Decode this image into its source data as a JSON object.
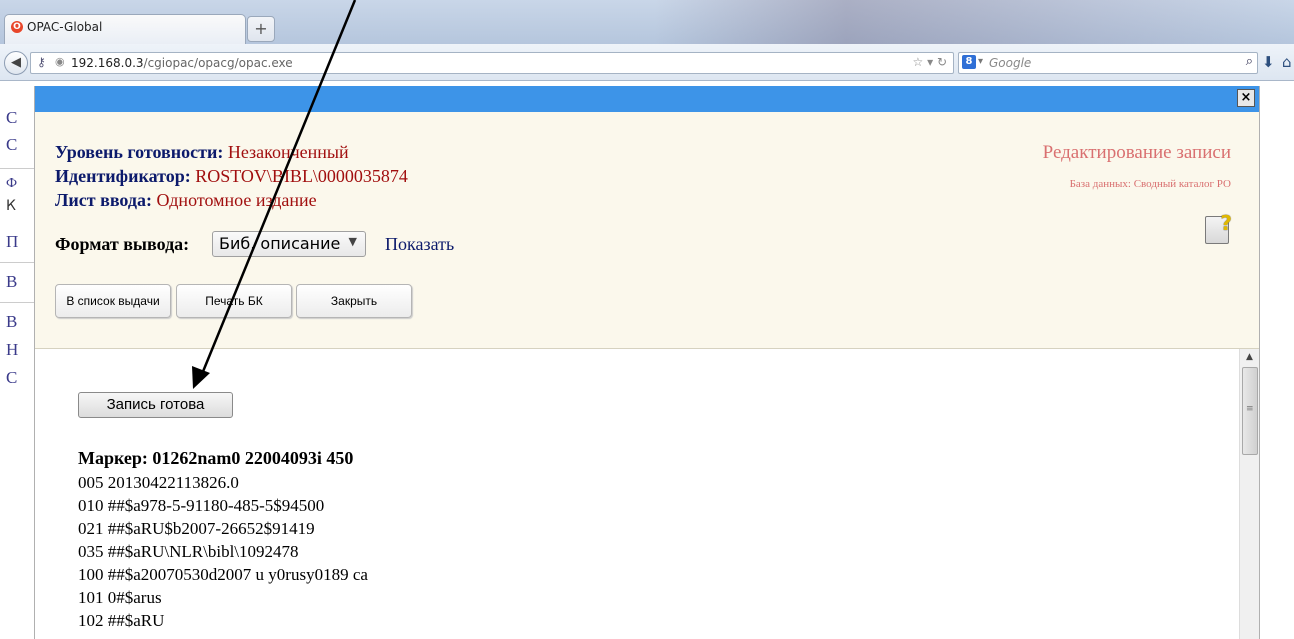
{
  "browser": {
    "tab_title": "OPAC-Global",
    "tab_icon": "opera-icon",
    "new_tab_label": "+",
    "url_host": "192.168.0.3",
    "url_path": "/cgiopac/opacg/opac.exe",
    "search_placeholder": "Google",
    "search_engine_letter": "8"
  },
  "background_page": {
    "letters": [
      "С",
      "С",
      "Ф",
      "К",
      "П",
      "В",
      "В",
      "Н",
      "С"
    ]
  },
  "dialog": {
    "close_label": "×",
    "status_label": "Уровень готовности:",
    "status_value": "Незаконченный",
    "id_label": "Идентификатор:",
    "id_value": "ROSTOV\\BIBL\\0000035874",
    "sheet_label": "Лист ввода:",
    "sheet_value": "Однотомное издание",
    "edit_title": "Редактирование записи",
    "db_label": "База данных: Сводный каталог РО",
    "format_label": "Формат вывода:",
    "format_value": "Биб. описание",
    "show_link": "Показать",
    "buttons": {
      "issue": "В список выдачи",
      "print": "Печать БК",
      "close": "Закрыть"
    }
  },
  "content": {
    "ready_button": "Запись готова",
    "marker": "Маркер: 01262nam0 22004093i 450",
    "lines": [
      "005 20130422113826.0",
      "010 ##$a978-5-91180-485-5$94500",
      "021 ##$aRU$b2007-26652$91419",
      "035 ##$aRU\\NLR\\bibl\\1092478",
      "100 ##$a20070530d2007 u y0rusy0189 ca",
      "101 0#$arus",
      "102 ##$aRU"
    ]
  },
  "colors": {
    "titlebar": "#3d94e8",
    "header_bg": "#fbf8ec",
    "label_blue": "#0c1a6b",
    "value_red": "#a10f0f",
    "edit_title": "#d97070"
  }
}
